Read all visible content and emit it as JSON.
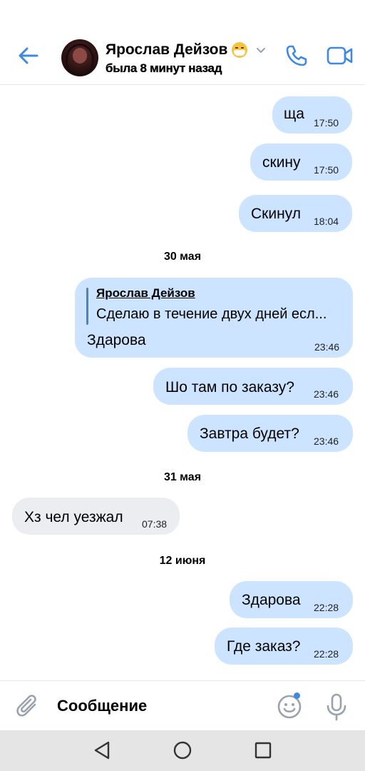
{
  "header": {
    "contact_name": "Ярослав Дейзов",
    "status": "была 8 минут назад"
  },
  "messages": [
    {
      "text": "ща",
      "time": "17:50"
    },
    {
      "text": "скину",
      "time": "17:50"
    },
    {
      "text": "Скинул",
      "time": "18:04"
    }
  ],
  "dates": [
    "30 мая",
    "31 мая",
    "12 июня"
  ],
  "reply_message": {
    "quoted_name": "Ярослав Дейзов",
    "quoted_text": "Сделаю в течение двух дней есл...",
    "text": "Здарова",
    "time": "23:46"
  },
  "messages2": [
    {
      "text": "Шо там по заказу?",
      "time": "23:46"
    },
    {
      "text": "Завтра будет?",
      "time": "23:46"
    }
  ],
  "incoming": {
    "text": "Хз чел уезжал",
    "time": "07:38"
  },
  "messages3": [
    {
      "text": "Здарова",
      "time": "22:28"
    },
    {
      "text": "Где заказ?",
      "time": "22:28"
    }
  ],
  "composer": {
    "placeholder": "Сообщение"
  },
  "colors": {
    "accent": "#3f8ae0",
    "outgoing_bubble": "#cce4ff",
    "incoming_bubble": "#ebedf0"
  }
}
